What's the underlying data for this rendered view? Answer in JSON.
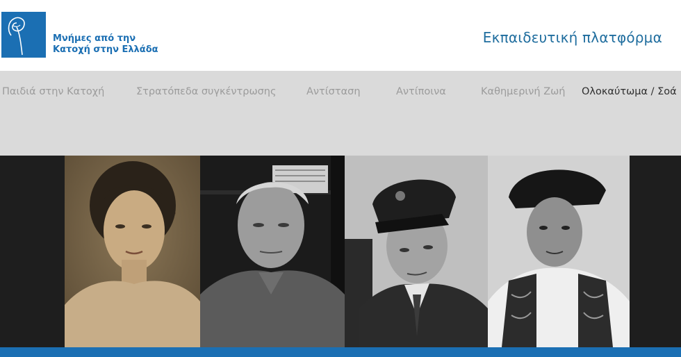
{
  "header": {
    "logo_line1": "Μνήμες από την",
    "logo_line2": "Κατοχή στην Ελλάδα",
    "platform_link": "Εκπαιδευτική πλατφόρμα"
  },
  "nav": {
    "items": [
      {
        "label": "Παιδιά στην Κατοχή",
        "active": false
      },
      {
        "label": "Στρατόπεδα συγκέντρωσης",
        "active": false
      },
      {
        "label": "Αντίσταση",
        "active": false
      },
      {
        "label": "Αντίποινα",
        "active": false
      },
      {
        "label": "Καθημερινή Ζωή",
        "active": false
      },
      {
        "label": "Ολοκαύτωμα / Σοά",
        "active": true
      }
    ]
  },
  "hero": {
    "photos": [
      {
        "name": "sepia-portrait-girl"
      },
      {
        "name": "elderly-man-portrait"
      },
      {
        "name": "boy-in-uniform-cap"
      },
      {
        "name": "child-in-traditional-costume"
      }
    ]
  },
  "colors": {
    "brand_blue": "#1b6fb3",
    "link_blue": "#1f6d9e",
    "nav_bg": "#dadada",
    "nav_text": "#9b9b9b",
    "nav_active": "#2e2e2e",
    "hero_bg": "#1e1e1e"
  }
}
